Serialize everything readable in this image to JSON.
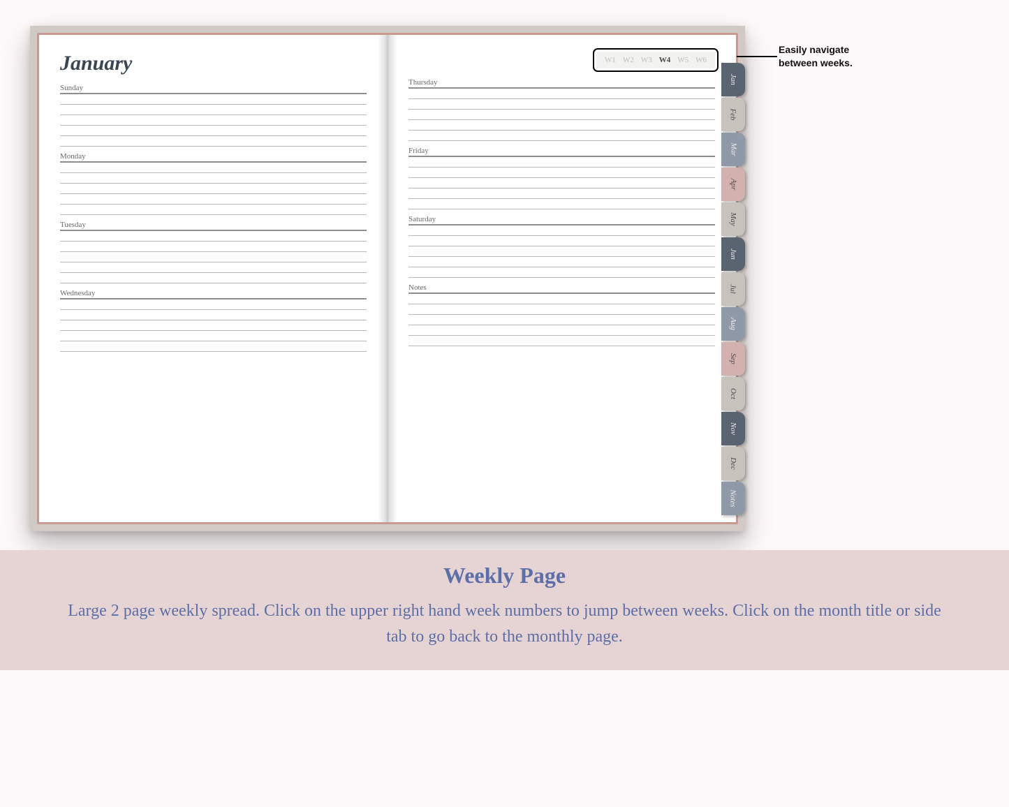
{
  "month_title": "January",
  "left_days": [
    "Sunday",
    "Monday",
    "Tuesday",
    "Wednesday"
  ],
  "right_days": [
    "Thursday",
    "Friday",
    "Saturday",
    "Notes"
  ],
  "weeks": [
    "W1",
    "W2",
    "W3",
    "W4",
    "W5",
    "W6"
  ],
  "active_week": "W4",
  "side_tabs": [
    {
      "label": "Jan",
      "cls": "dark"
    },
    {
      "label": "Feb",
      "cls": "sage"
    },
    {
      "label": "Mar",
      "cls": "blue"
    },
    {
      "label": "Apr",
      "cls": "rose"
    },
    {
      "label": "May",
      "cls": "sage"
    },
    {
      "label": "Jun",
      "cls": "dark"
    },
    {
      "label": "Jul",
      "cls": "sage"
    },
    {
      "label": "Aug",
      "cls": "blue"
    },
    {
      "label": "Sep",
      "cls": "rose"
    },
    {
      "label": "Oct",
      "cls": "sage"
    },
    {
      "label": "Nov",
      "cls": "dark"
    },
    {
      "label": "Dec",
      "cls": "sage"
    },
    {
      "label": "Notes",
      "cls": "blue"
    }
  ],
  "callout_text": "Easily navigate between weeks.",
  "footer": {
    "title": "Weekly Page",
    "body": "Large 2 page weekly spread. Click on the upper right hand week numbers to jump between weeks. Click on the month title or side tab to go back to the monthly page."
  }
}
